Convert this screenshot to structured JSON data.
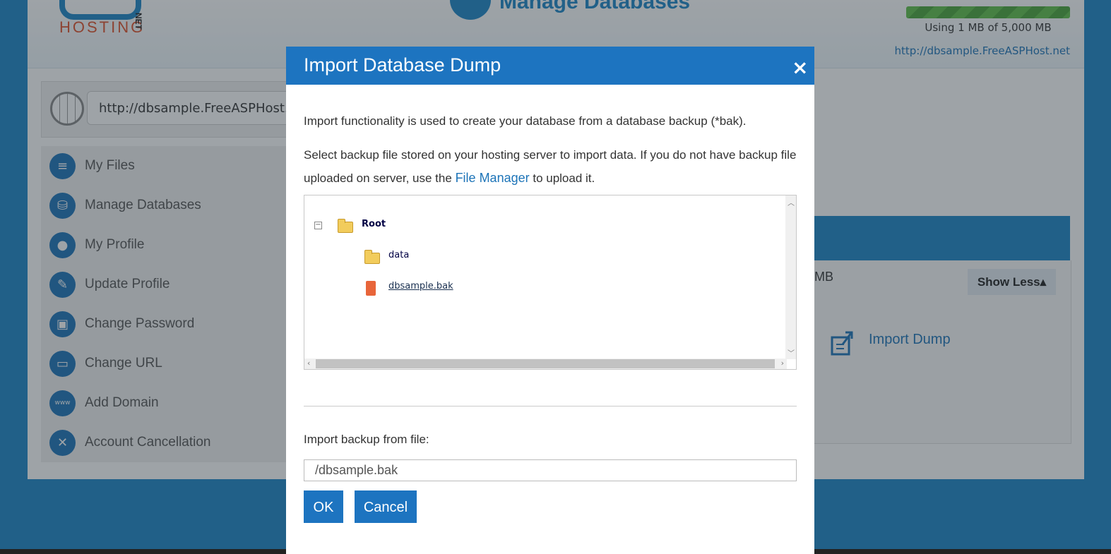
{
  "header": {
    "logo_text": "HOSTING",
    "logo_suffix": "NET",
    "title": "Manage Databases",
    "usage_text": "Using 1 MB of 5,000 MB",
    "usage_fraction": 0.0002,
    "site_url": "http://dbsample.FreeASPHost.net"
  },
  "url_box": {
    "value": "http://dbsample.FreeASPHost.net"
  },
  "sidebar": {
    "items": [
      {
        "label": "My Files",
        "icon": "files-icon"
      },
      {
        "label": "Manage Databases",
        "icon": "database-icon"
      },
      {
        "label": "My Profile",
        "icon": "profile-icon"
      },
      {
        "label": "Update Profile",
        "icon": "edit-profile-icon"
      },
      {
        "label": "Change Password",
        "icon": "lock-icon"
      },
      {
        "label": "Change URL",
        "icon": "url-icon"
      },
      {
        "label": "Add Domain",
        "icon": "www-icon"
      },
      {
        "label": "Account Cancellation",
        "icon": "close-circle-icon"
      }
    ]
  },
  "main_panel": {
    "mb_text": "MB",
    "show_less": "Show Less",
    "import_dump": "Import Dump"
  },
  "modal": {
    "title": "Import Database Dump",
    "close": "×",
    "para1": "Import functionality is used to create your database from a database backup (*bak).",
    "para2_before": "Select backup file stored on your hosting server to import data. If you do not have backup file uploaded on server, use the",
    "file_manager_link": "File Manager",
    "para2_after": "to upload it.",
    "tree": {
      "root": "Root",
      "children": [
        {
          "name": "data",
          "type": "folder"
        },
        {
          "name": "dbsample.bak",
          "type": "file"
        }
      ]
    },
    "import_label": "Import backup from file:",
    "import_value": "/dbsample.bak",
    "ok_label": "OK",
    "cancel_label": "Cancel"
  }
}
